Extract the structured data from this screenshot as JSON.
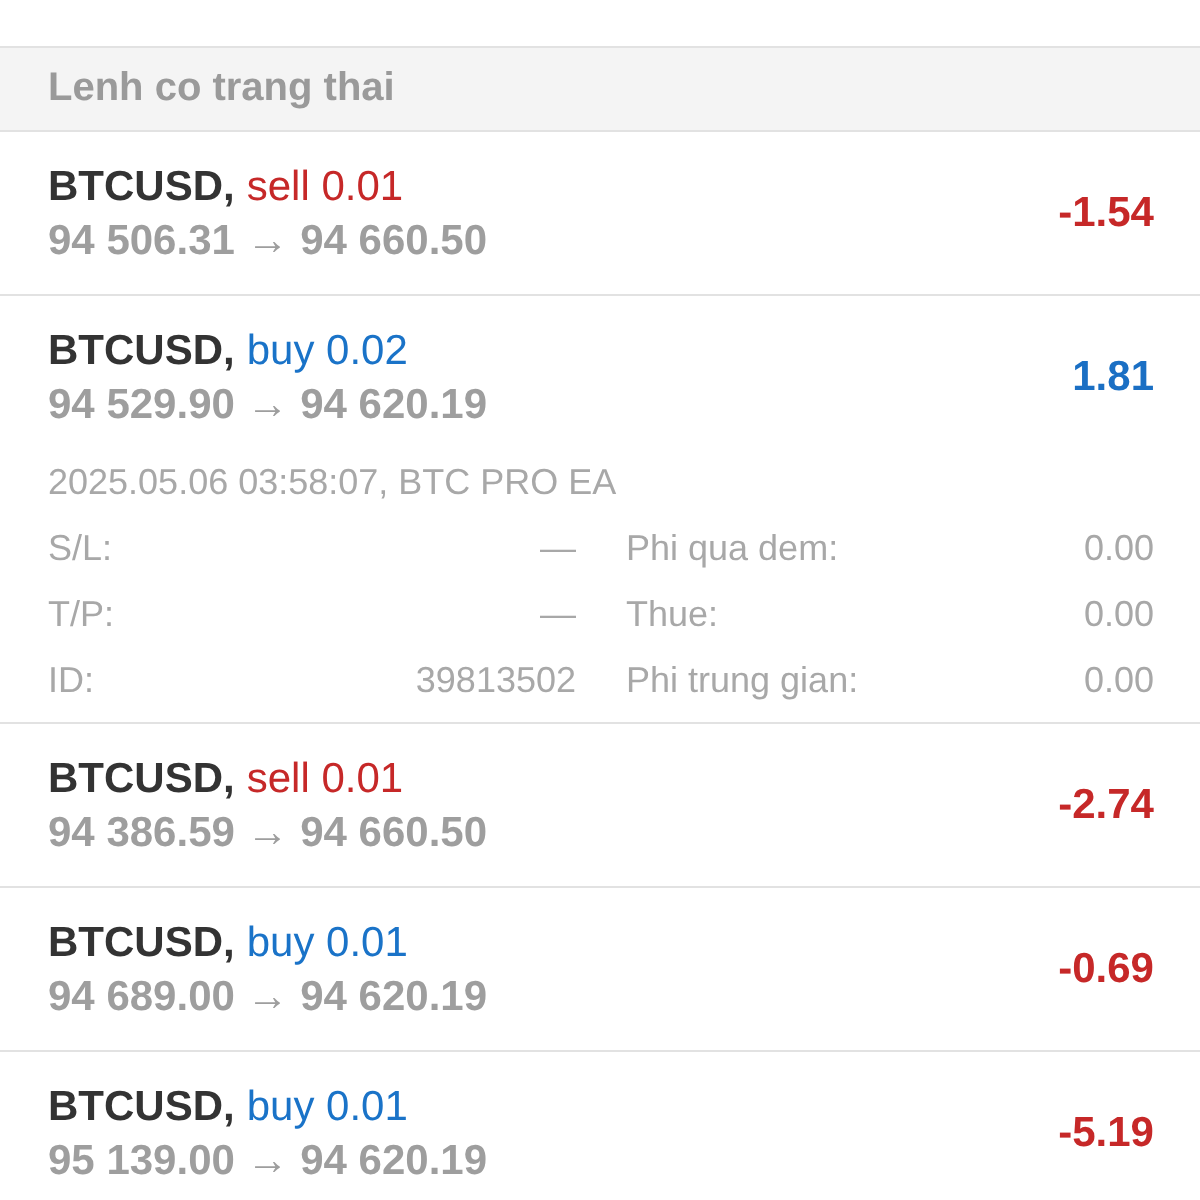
{
  "section": {
    "title": "Lenh co trang thai"
  },
  "trades": [
    {
      "symbol": "BTCUSD,",
      "order": "sell 0.01",
      "kind": "sell",
      "prices": "94 506.31 → 94 660.50",
      "profit": "-1.54",
      "loss": true,
      "expanded": false
    },
    {
      "symbol": "BTCUSD,",
      "order": "buy 0.02",
      "kind": "buy",
      "prices": "94 529.90 → 94 620.19",
      "profit": "1.81",
      "loss": false,
      "expanded": true,
      "opened": "2025.05.06 03:58:07, BTC PRO EA",
      "details": [
        {
          "label": "S/L:",
          "value": "—",
          "label_2": "Phi qua dem:",
          "value_2": "0.00"
        },
        {
          "label": "T/P:",
          "value": "—",
          "label_2": "Thue:",
          "value_2": "0.00"
        },
        {
          "label": "ID:",
          "value": "39813502",
          "label_2": "Phi trung gian:",
          "value_2": "0.00"
        }
      ]
    },
    {
      "symbol": "BTCUSD,",
      "order": "sell 0.01",
      "kind": "sell",
      "prices": "94 386.59 → 94 660.50",
      "profit": "-2.74",
      "loss": true,
      "expanded": false
    },
    {
      "symbol": "BTCUSD,",
      "order": "buy 0.01",
      "kind": "buy",
      "prices": "94 689.00 → 94 620.19",
      "profit": "-0.69",
      "loss": true,
      "expanded": false
    },
    {
      "symbol": "BTCUSD,",
      "order": "buy 0.01",
      "kind": "buy",
      "prices": "95 139.00 → 94 620.19",
      "profit": "-5.19",
      "loss": true,
      "expanded": false
    }
  ]
}
